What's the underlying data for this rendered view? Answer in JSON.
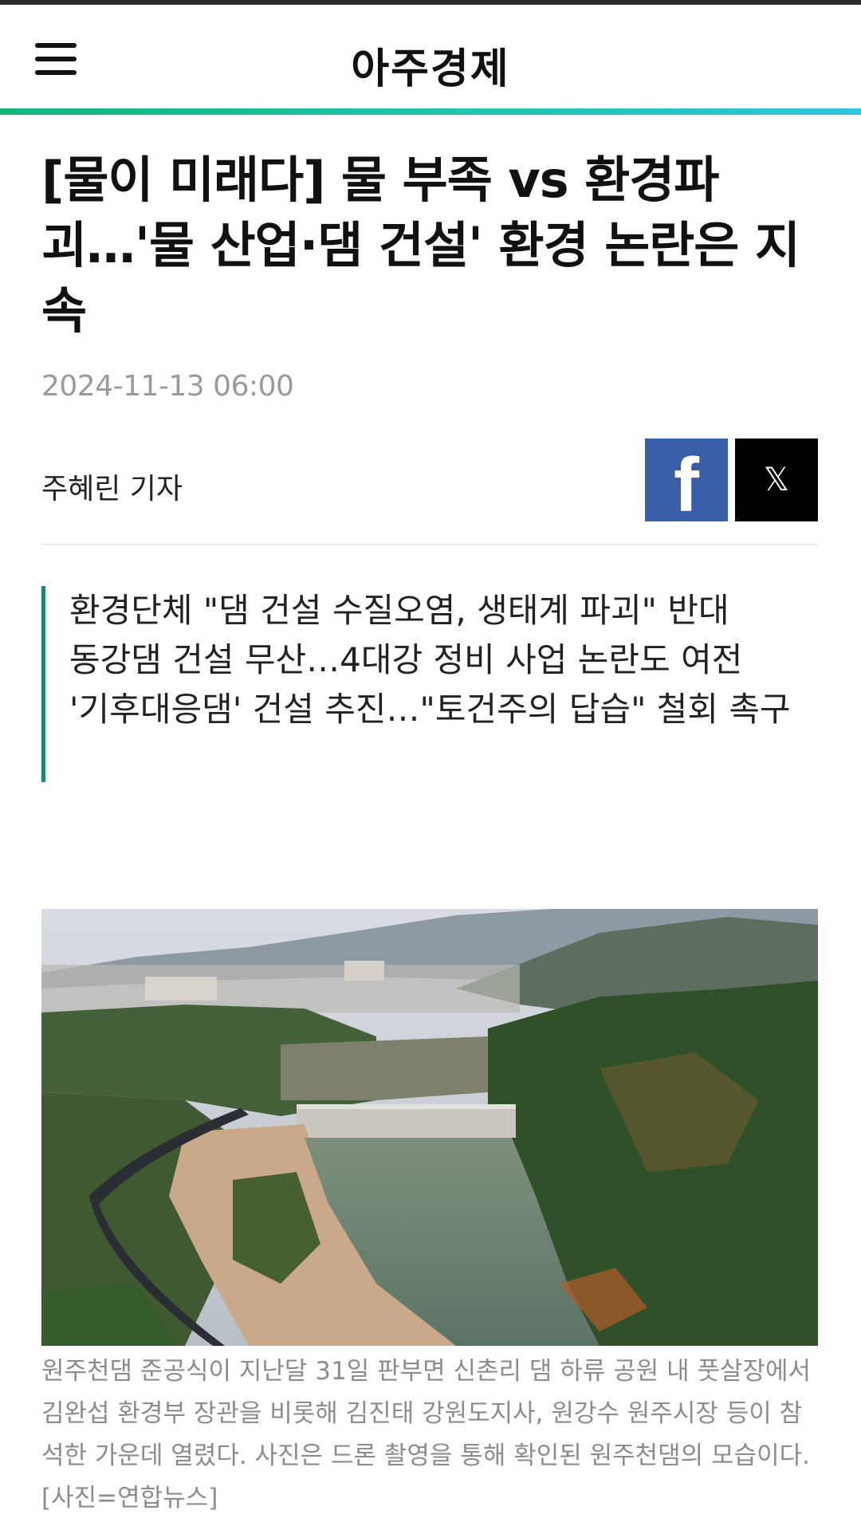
{
  "header": {
    "logo": "아주경제",
    "menu_icon": "hamburger-menu-icon"
  },
  "article": {
    "headline": "[물이 미래다] 물 부족 vs 환경파괴…'물 산업·댐 건설' 환경 논란은 지속",
    "date": "2024-11-13 06:00",
    "byline": "주혜린 기자",
    "share": {
      "facebook_icon": "facebook-icon",
      "x_icon": "x-icon"
    },
    "summary": [
      "환경단체 \"댐 건설 수질오염, 생태계 파괴\" 반대",
      "동강댐 건설 무산…4대강 정비 사업 논란도 여전",
      "'기후대응댐' 건설 추진…\"토건주의 답습\" 철회 촉구"
    ],
    "photo_caption": "원주천댐 준공식이 지난달 31일 판부면 신촌리 댐 하류 공원 내 풋살장에서 김완섭 환경부 장관을 비롯해 김진태 강원도지사, 원강수 원주시장 등이 참석한 가운데 열렸다. 사진은 드론 촬영을 통해 확인된 원주천댐의 모습이다. [사진=연합뉴스]"
  },
  "colors": {
    "accent_gradient_start": "#12b57a",
    "accent_gradient_end": "#2fc5de",
    "summary_bar": "#1f8a6a",
    "facebook": "#3b5ea8",
    "x": "#000000",
    "date_text": "#9a9a9a",
    "caption_text": "#8c8c8c"
  }
}
